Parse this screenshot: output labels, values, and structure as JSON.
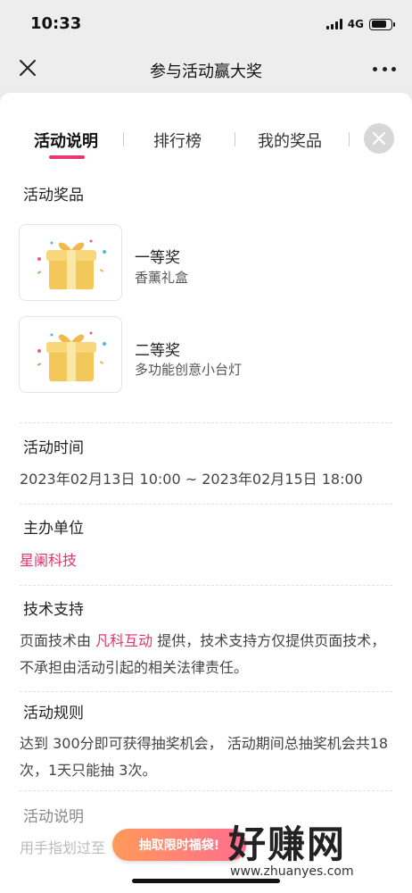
{
  "status": {
    "time": "10:33",
    "network": "4G"
  },
  "nav": {
    "title": "参与活动赢大奖"
  },
  "tabs": [
    {
      "label": "活动说明"
    },
    {
      "label": "排行榜"
    },
    {
      "label": "我的奖品"
    }
  ],
  "prizes_section": {
    "title": "活动奖品"
  },
  "prizes": [
    {
      "name": "一等奖",
      "desc": "香薰礼盒"
    },
    {
      "name": "二等奖",
      "desc": "多功能创意小台灯"
    }
  ],
  "time_section": {
    "title": "活动时间",
    "value": "2023年02月13日 10:00 ~ 2023年02月15日 18:00"
  },
  "organizer_section": {
    "title": "主办单位",
    "value": "星阑科技"
  },
  "tech_section": {
    "title": "技术支持",
    "prefix": "页面技术由 ",
    "provider": "凡科互动",
    "suffix": " 提供，技术支持方仅提供页面技术，不承担由活动引起的相关法律责任。"
  },
  "rules_section": {
    "title": "活动规则",
    "value": "达到 300分即可获得抽奖机会， 活动期间总抽奖机会共18 次，1天只能抽 3次。"
  },
  "desc_section": {
    "title": "活动说明",
    "value": "用手指划过至"
  },
  "banner": {
    "label": "抽取限时福袋!"
  },
  "watermark": {
    "big": "好赚网",
    "small": "www.zhuanyes.com"
  },
  "colors": {
    "accent": "#e8386d",
    "highlight": "#fbe1e9"
  }
}
